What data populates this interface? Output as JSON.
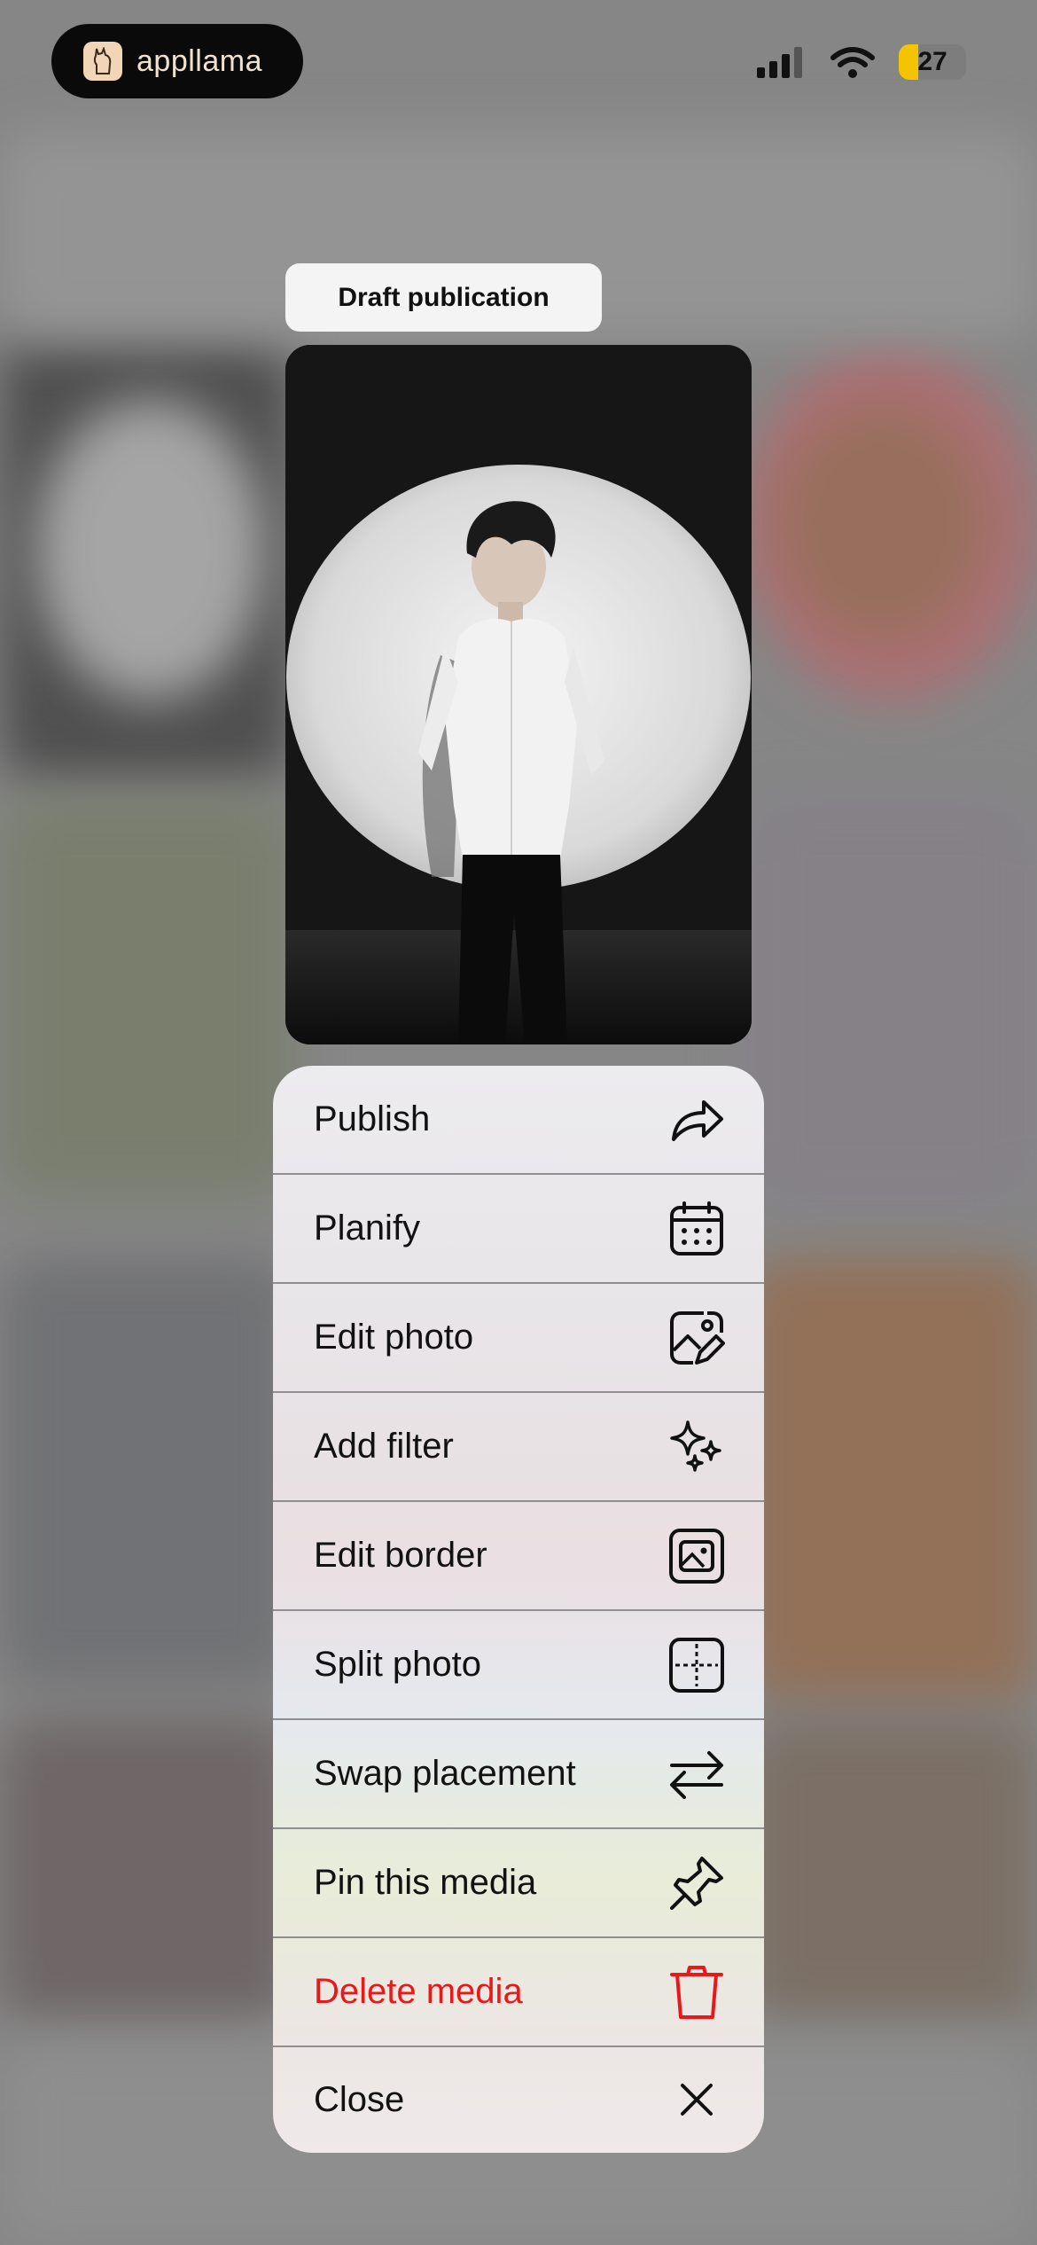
{
  "status_bar": {
    "app_brand": "appllama",
    "battery_level": "27",
    "icons": [
      "cellular-signal-icon",
      "wifi-icon",
      "battery-icon"
    ]
  },
  "draft": {
    "label": "Draft publication"
  },
  "menu": {
    "items": [
      {
        "label": "Publish",
        "icon": "share-arrow-icon"
      },
      {
        "label": "Planify",
        "icon": "calendar-icon"
      },
      {
        "label": "Edit photo",
        "icon": "edit-photo-icon"
      },
      {
        "label": "Add filter",
        "icon": "sparkles-icon"
      },
      {
        "label": "Edit border",
        "icon": "border-photo-icon"
      },
      {
        "label": "Split photo",
        "icon": "split-grid-icon"
      },
      {
        "label": "Swap placement",
        "icon": "swap-arrows-icon"
      },
      {
        "label": "Pin this media",
        "icon": "pin-icon"
      },
      {
        "label": "Delete media",
        "icon": "trash-icon"
      },
      {
        "label": "Close",
        "icon": "close-icon"
      }
    ],
    "danger_color": "#e8181b"
  }
}
